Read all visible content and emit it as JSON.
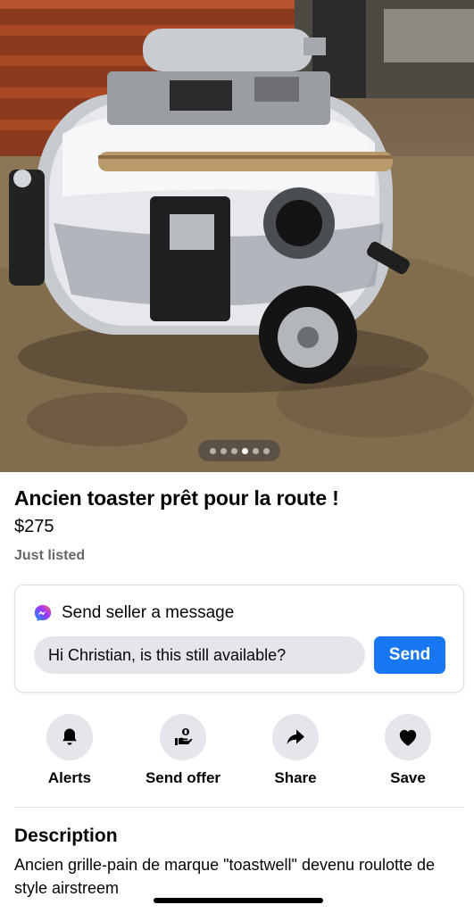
{
  "photo": {
    "alt": "Chrome toaster converted into a small travel trailer",
    "image_count": 6,
    "active_index": 4
  },
  "listing": {
    "title": "Ancien toaster prêt pour la route !",
    "price": "$275",
    "listed_status": "Just listed"
  },
  "message": {
    "heading": "Send seller a message",
    "input_value": "Hi Christian, is this still available?",
    "send_label": "Send",
    "icon": "messenger-icon"
  },
  "actions": [
    {
      "label": "Alerts",
      "icon": "bell-icon"
    },
    {
      "label": "Send offer",
      "icon": "offer-hand-icon"
    },
    {
      "label": "Share",
      "icon": "share-arrow-icon"
    },
    {
      "label": "Save",
      "icon": "heart-icon"
    }
  ],
  "description": {
    "heading": "Description",
    "text": "Ancien grille-pain de marque \"toastwell\" devenu roulotte de style airstreem"
  },
  "colors": {
    "accent": "#1877f2",
    "secondary_text": "#65676b",
    "action_bg": "#e4e6eb"
  }
}
